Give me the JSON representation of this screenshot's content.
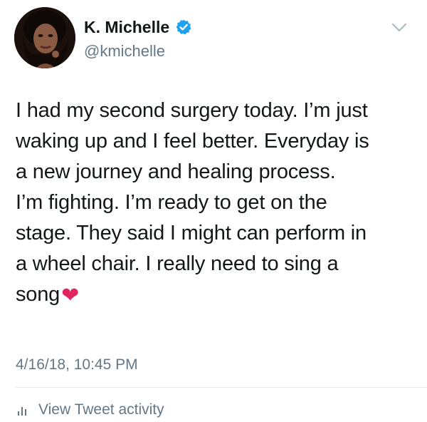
{
  "user": {
    "display_name": "K. Michelle",
    "handle": "@kmichelle",
    "verified_icon": "verified-badge-icon",
    "avatar_icon": "profile-avatar"
  },
  "menu_icon": "chevron-down-icon",
  "tweet": {
    "lines": [
      "I had my second surgery today. I’m just",
      "waking up and I feel better. Everyday is",
      "a new journey and healing process.",
      "I’m fighting. I’m ready to get on the",
      "stage. They said I might can perform in",
      "a wheel chair. I really need to sing a",
      "song"
    ],
    "emoji": "❤"
  },
  "timestamp": "4/16/18, 10:45 PM",
  "activity": {
    "label": "View Tweet activity",
    "icon": "bar-chart-icon"
  },
  "colors": {
    "text": "#14171a",
    "secondary": "#657786",
    "verified": "#1da1f2",
    "heart": "#e0245e",
    "divider": "#e1e8ed"
  }
}
